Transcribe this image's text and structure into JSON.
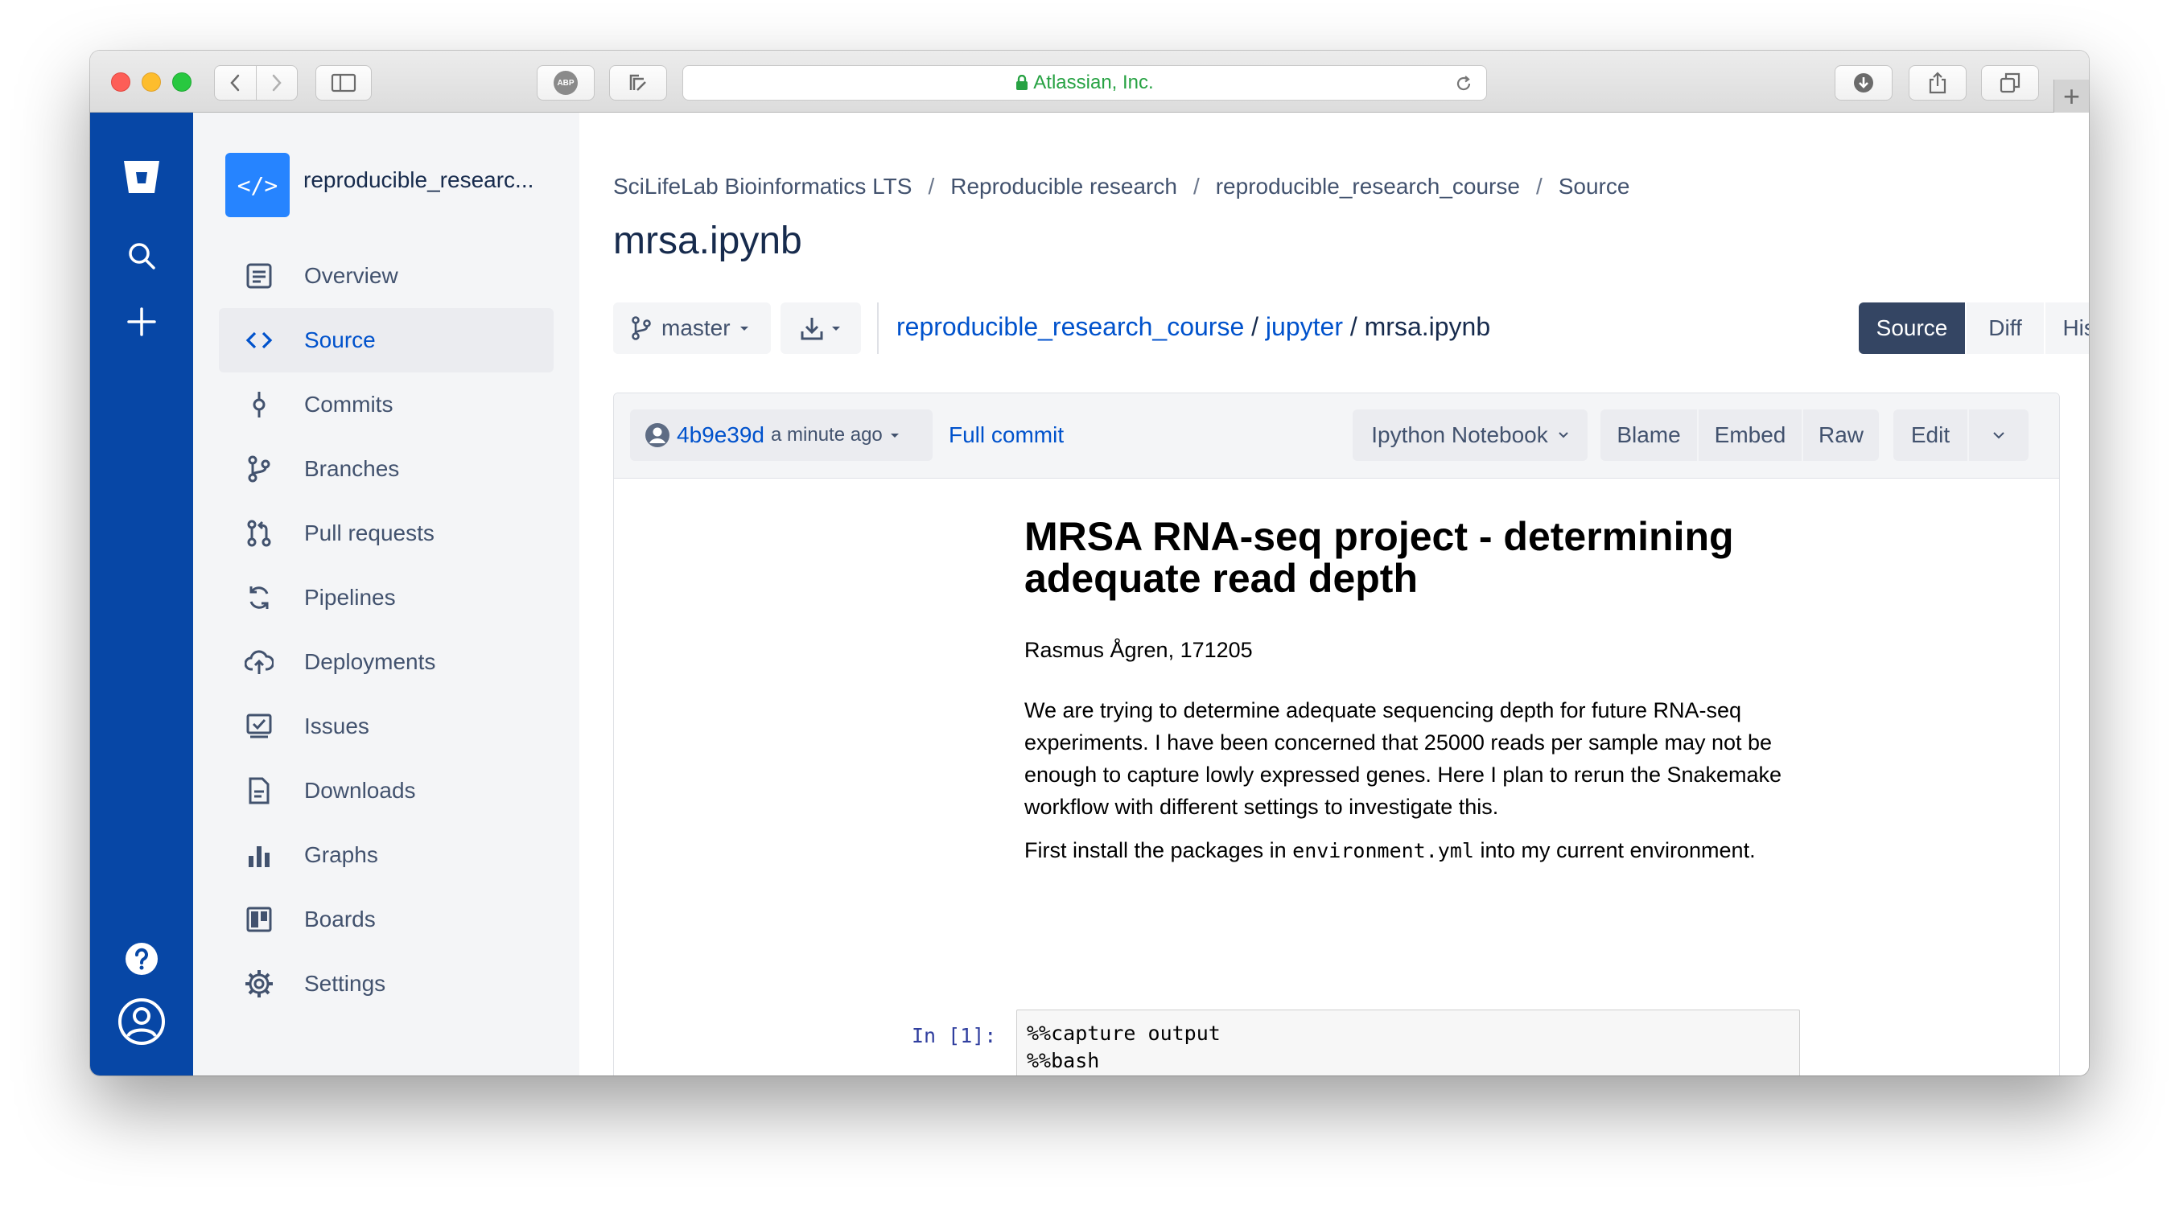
{
  "browser": {
    "address": "Atlassian, Inc.",
    "abp_label": "ABP"
  },
  "sidebar": {
    "repo_icon": "</>",
    "repo_name": "reproducible_researc...",
    "items": [
      {
        "label": "Overview",
        "icon": "overview-icon"
      },
      {
        "label": "Source",
        "icon": "source-icon",
        "active": true
      },
      {
        "label": "Commits",
        "icon": "commits-icon"
      },
      {
        "label": "Branches",
        "icon": "branches-icon"
      },
      {
        "label": "Pull requests",
        "icon": "pull-requests-icon"
      },
      {
        "label": "Pipelines",
        "icon": "pipelines-icon"
      },
      {
        "label": "Deployments",
        "icon": "deployments-icon"
      },
      {
        "label": "Issues",
        "icon": "issues-icon"
      },
      {
        "label": "Downloads",
        "icon": "downloads-icon"
      },
      {
        "label": "Graphs",
        "icon": "graphs-icon"
      },
      {
        "label": "Boards",
        "icon": "boards-icon"
      },
      {
        "label": "Settings",
        "icon": "settings-icon"
      }
    ]
  },
  "breadcrumb": [
    "SciLifeLab Bioinformatics LTS",
    "Reproducible research",
    "reproducible_research_course",
    "Source"
  ],
  "page_title": "mrsa.ipynb",
  "branch": "master",
  "filepath": {
    "repo": "reproducible_research_course",
    "folder": "jupyter",
    "file": "mrsa.ipynb",
    "separator": " / "
  },
  "view_tabs": {
    "source": "Source",
    "diff": "Diff",
    "history": "History"
  },
  "file_header": {
    "commit_hash": "4b9e39d",
    "commit_time": "a minute ago",
    "full_commit": "Full commit",
    "viewer": "Ipython Notebook",
    "blame": "Blame",
    "embed": "Embed",
    "raw": "Raw",
    "edit": "Edit"
  },
  "notebook": {
    "title": "MRSA RNA-seq project - determining adequate read depth",
    "author": "Rasmus Ågren, 171205",
    "para1": "We are trying to determine adequate sequencing depth for future RNA-seq experiments. I have been concerned that 25000 reads per sample may not be enough to capture lowly expressed genes. Here I plan to rerun the Snakemake workflow with different settings to investigate this.",
    "para2_before": "First install the packages in ",
    "para2_code": "environment.yml",
    "para2_after": " into my current environment.",
    "prompt": "In [1]:",
    "code_lines": [
      "%%capture output",
      "%%bash"
    ]
  },
  "colors": {
    "global_nav": "#0747a6",
    "accent": "#0052cc",
    "active_tab": "#344563"
  }
}
